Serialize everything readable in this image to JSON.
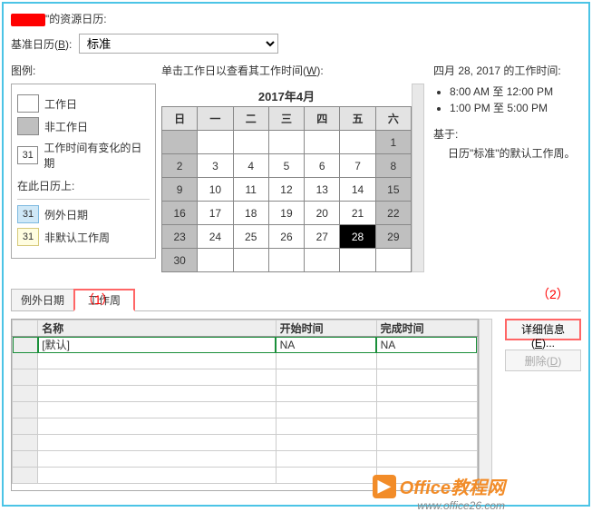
{
  "header": {
    "title_suffix": "\"的资源日历:"
  },
  "base_calendar": {
    "label_pre": "基准日历(",
    "label_u": "B",
    "label_post": "):",
    "value": "标准"
  },
  "legend": {
    "title": "图例:",
    "items": [
      {
        "label": "工作日"
      },
      {
        "label": "非工作日"
      },
      {
        "num": "31",
        "label": "工作时间有变化的日期"
      }
    ],
    "sub_title": "在此日历上:",
    "sub_items": [
      {
        "num": "31",
        "label": "例外日期"
      },
      {
        "num": "31",
        "label": "非默认工作周"
      }
    ]
  },
  "middle": {
    "instruction_pre": "单击工作日以查看其工作时间(",
    "instruction_u": "W",
    "instruction_post": "):",
    "calendar": {
      "title": "2017年4月",
      "dow": [
        "日",
        "一",
        "二",
        "三",
        "四",
        "五",
        "六"
      ],
      "weeks": [
        [
          {
            "v": "",
            "c": "grey"
          },
          {
            "v": ""
          },
          {
            "v": ""
          },
          {
            "v": ""
          },
          {
            "v": ""
          },
          {
            "v": ""
          },
          {
            "v": "1",
            "c": "grey"
          }
        ],
        [
          {
            "v": "2",
            "c": "grey"
          },
          {
            "v": "3"
          },
          {
            "v": "4"
          },
          {
            "v": "5"
          },
          {
            "v": "6"
          },
          {
            "v": "7"
          },
          {
            "v": "8",
            "c": "grey"
          }
        ],
        [
          {
            "v": "9",
            "c": "grey"
          },
          {
            "v": "10"
          },
          {
            "v": "11"
          },
          {
            "v": "12"
          },
          {
            "v": "13"
          },
          {
            "v": "14"
          },
          {
            "v": "15",
            "c": "grey"
          }
        ],
        [
          {
            "v": "16",
            "c": "grey"
          },
          {
            "v": "17"
          },
          {
            "v": "18"
          },
          {
            "v": "19"
          },
          {
            "v": "20"
          },
          {
            "v": "21"
          },
          {
            "v": "22",
            "c": "grey"
          }
        ],
        [
          {
            "v": "23",
            "c": "grey"
          },
          {
            "v": "24"
          },
          {
            "v": "25"
          },
          {
            "v": "26"
          },
          {
            "v": "27"
          },
          {
            "v": "28",
            "c": "black"
          },
          {
            "v": "29",
            "c": "grey"
          }
        ],
        [
          {
            "v": "30",
            "c": "grey"
          },
          {
            "v": ""
          },
          {
            "v": ""
          },
          {
            "v": ""
          },
          {
            "v": ""
          },
          {
            "v": ""
          },
          {
            "v": ""
          }
        ]
      ]
    }
  },
  "right": {
    "heading": "四月 28, 2017 的工作时间:",
    "times": [
      "8:00 AM 至 12:00 PM",
      "1:00 PM 至 5:00 PM"
    ],
    "based_label": "基于:",
    "based_text": "日历\"标准\"的默认工作周。"
  },
  "annotations": {
    "one": "（1）",
    "two": "（2）"
  },
  "tabs": {
    "tab1": "例外日期",
    "tab2": "工作周"
  },
  "grid": {
    "headers": {
      "name": "名称",
      "start": "开始时间",
      "end": "完成时间"
    },
    "rows": [
      {
        "name": "[默认]",
        "start": "NA",
        "end": "NA"
      }
    ]
  },
  "buttons": {
    "details_pre": "详细信息(",
    "details_u": "E",
    "details_post": ")...",
    "delete_pre": "删除(",
    "delete_u": "D",
    "delete_post": ")"
  },
  "watermark": {
    "brand": "Office教程网",
    "url": "www.office26.com"
  }
}
